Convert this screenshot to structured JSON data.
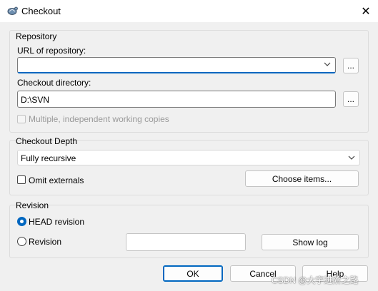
{
  "window": {
    "title": "Checkout",
    "close_glyph": "✕"
  },
  "repository": {
    "group_label": "Repository",
    "url_label": "URL of repository:",
    "url_value": "",
    "url_browse": "...",
    "dir_label": "Checkout directory:",
    "dir_value": "D:\\SVN",
    "dir_browse": "...",
    "multiple_label": "Multiple, independent working copies",
    "multiple_checked": false,
    "multiple_enabled": false
  },
  "depth": {
    "group_label": "Checkout Depth",
    "selected": "Fully recursive",
    "omit_label": "Omit externals",
    "omit_checked": false,
    "choose_items": "Choose items..."
  },
  "revision": {
    "group_label": "Revision",
    "head_label": "HEAD revision",
    "head_selected": true,
    "rev_label": "Revision",
    "rev_value": "",
    "show_log": "Show log"
  },
  "footer": {
    "ok": "OK",
    "cancel": "Cancel",
    "help": "Help"
  },
  "watermark": "CSDN @大宇进阶之路",
  "colors": {
    "accent": "#0067c0",
    "background": "#f0f0f0"
  },
  "icons": {
    "app": "tortoise-svn-icon",
    "close": "close-icon",
    "dropdown": "chevron-down-icon"
  }
}
